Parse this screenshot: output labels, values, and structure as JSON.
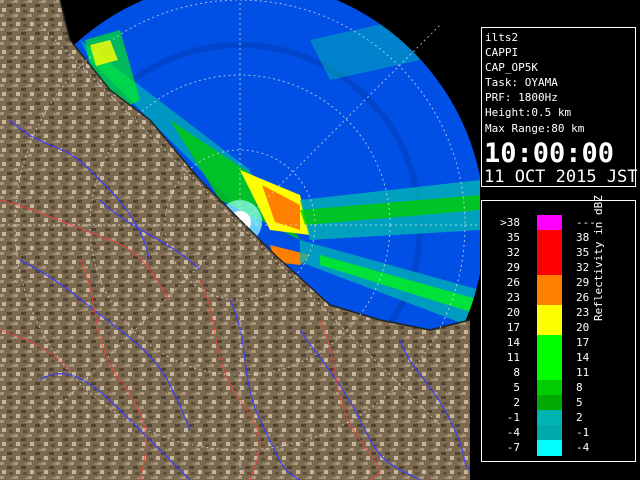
{
  "info": {
    "station": "ilts2",
    "product": "CAPPI",
    "product_code": "CAP_OP5K",
    "task": "Task: OYAMA",
    "prf": "PRF: 1800Hz",
    "height": "Height:0.5 km",
    "max_range": "Max Range:80 km",
    "time": "10:00:00",
    "date": "11 OCT 2015 JST"
  },
  "legend": {
    "title": "Reflectivity in dBZ",
    "rows": [
      {
        "low": ">38",
        "high": "---",
        "color": "#ff00ff"
      },
      {
        "low": "35",
        "high": "38",
        "color": "#ff0000"
      },
      {
        "low": "32",
        "high": "35",
        "color": "#ff0000"
      },
      {
        "low": "29",
        "high": "32",
        "color": "#ff0000"
      },
      {
        "low": "26",
        "high": "29",
        "color": "#ff7f00"
      },
      {
        "low": "23",
        "high": "26",
        "color": "#ff7f00"
      },
      {
        "low": "20",
        "high": "23",
        "color": "#ffff00"
      },
      {
        "low": "17",
        "high": "20",
        "color": "#ffff00"
      },
      {
        "low": "14",
        "high": "17",
        "color": "#00ff00"
      },
      {
        "low": "11",
        "high": "14",
        "color": "#00ff00"
      },
      {
        "low": "8",
        "high": "11",
        "color": "#00ff00"
      },
      {
        "low": "5",
        "high": "8",
        "color": "#00cc00"
      },
      {
        "low": "2",
        "high": "5",
        "color": "#00aa00"
      },
      {
        "low": "-1",
        "high": "2",
        "color": "#00b4b4"
      },
      {
        "low": "-4",
        "high": "-1",
        "color": "#00aaaa"
      },
      {
        "low": "-7",
        "high": "-4",
        "color": "#00ffff"
      }
    ]
  },
  "colors": {
    "coverage": "#0050e6",
    "terrain": "#7a6a52",
    "rivers": "#3c3cff",
    "boundaries": "#ff3c3c"
  }
}
